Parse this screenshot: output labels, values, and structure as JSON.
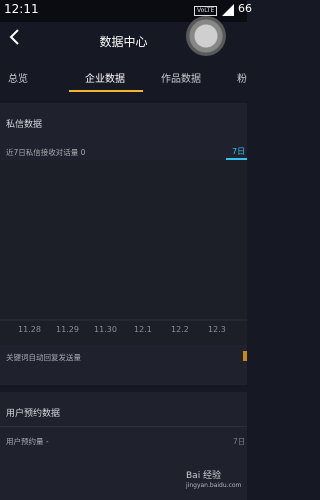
{
  "status": {
    "time": "12:11",
    "network": "VoLTE",
    "battery": "66"
  },
  "header": {
    "title": "数据中心"
  },
  "tabs": [
    "总览",
    "企业数据",
    "作品数据",
    "粉"
  ],
  "private_message": {
    "title": "私信数据",
    "metric_label": "近7日私信接收对话量 0",
    "range_tab": "7日",
    "x_ticks": [
      "11.28",
      "11.29",
      "11.30",
      "12.1",
      "12.2",
      "12.3"
    ],
    "keyword_label": "关键词自动回复发送量"
  },
  "reservation": {
    "title": "用户预约数据",
    "metric_label": "用户预约量 -",
    "range_tab": "7日"
  },
  "watermark": {
    "brand": "Bai 经验",
    "sub": "jingyan.baidu.com"
  },
  "colors": {
    "accent": "#f2b52c",
    "link": "#39c0f0",
    "background": "#161823",
    "card": "#1f212c"
  }
}
